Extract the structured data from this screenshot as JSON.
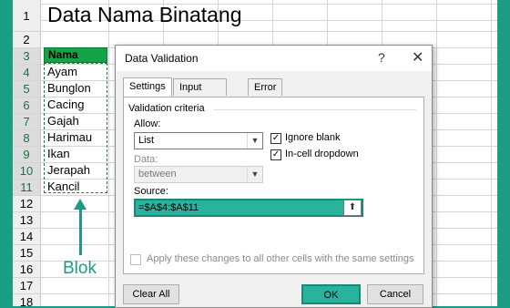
{
  "sheet": {
    "title": "Data Nama Binatang",
    "row_numbers": [
      "1",
      "2",
      "3",
      "4",
      "5",
      "6",
      "7",
      "8",
      "9",
      "10",
      "11",
      "12",
      "13",
      "14",
      "15",
      "16",
      "17",
      "18"
    ],
    "header": "Nama",
    "names": [
      "Ayam",
      "Bunglon",
      "Cacing",
      "Gajah",
      "Harimau",
      "Ikan",
      "Jerapah",
      "Kancil"
    ],
    "annotation": "Blok",
    "accent_color": "#1b9c85"
  },
  "dialog": {
    "title": "Data Validation",
    "help_glyph": "?",
    "close_glyph": "✕",
    "tabs": [
      "Settings",
      "Input Message",
      "Error Alert"
    ],
    "section": "Validation criteria",
    "allow_label": "Allow:",
    "allow_value": "List",
    "data_label": "Data:",
    "data_value": "between",
    "ignore_blank": "Ignore blank",
    "in_cell_dropdown": "In-cell dropdown",
    "ignore_blank_checked": true,
    "in_cell_dropdown_checked": true,
    "source_label": "Source:",
    "source_value": "=$A$4:$A$11",
    "apply_text": "Apply these changes to all other cells with the same settings",
    "clear_all": "Clear All",
    "ok": "OK",
    "cancel": "Cancel"
  }
}
